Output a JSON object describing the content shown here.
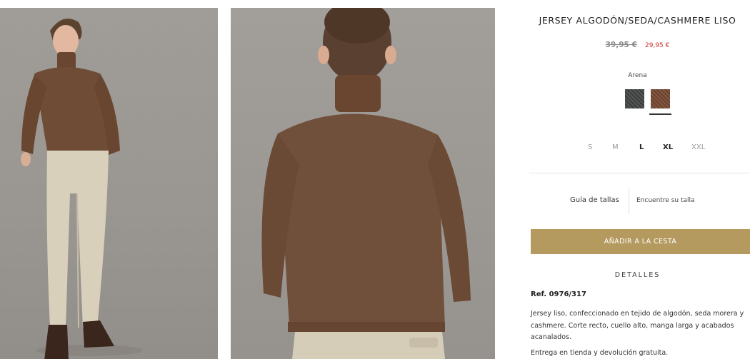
{
  "product": {
    "title": "JERSEY ALGODÓN/SEDA/CASHMERE LISO",
    "price_old": "39,95 €",
    "price_new": "29,95 €",
    "color_label": "Arena",
    "colors": [
      "grey-swatch",
      "brown-swatch"
    ],
    "selected_color_index": 1,
    "sizes": [
      {
        "label": "S",
        "available": false
      },
      {
        "label": "M",
        "available": false
      },
      {
        "label": "L",
        "available": true
      },
      {
        "label": "XL",
        "available": true
      },
      {
        "label": "XXL",
        "available": false
      }
    ],
    "size_guide": "Guía de tallas",
    "find_size": "Encuentre su talla",
    "add_to_cart": "AÑADIR A LA CESTA",
    "details_heading": "DETALLES",
    "reference": "Ref. 0976/317",
    "description_lines": [
      "Jersey liso, confeccionado en tejido de algodón, seda morera y",
      "cashmere. Corte recto, cuello alto, manga larga y acabados",
      "acanalados."
    ],
    "shipping": "Entrega en tienda y devolución gratuita."
  },
  "colors": {
    "accent_button": "#b59a5f",
    "sale_price": "#d0312d",
    "sweater_brown": "#6f4c36",
    "trousers_beige": "#d9d0bc",
    "backdrop": "#9c9894"
  }
}
